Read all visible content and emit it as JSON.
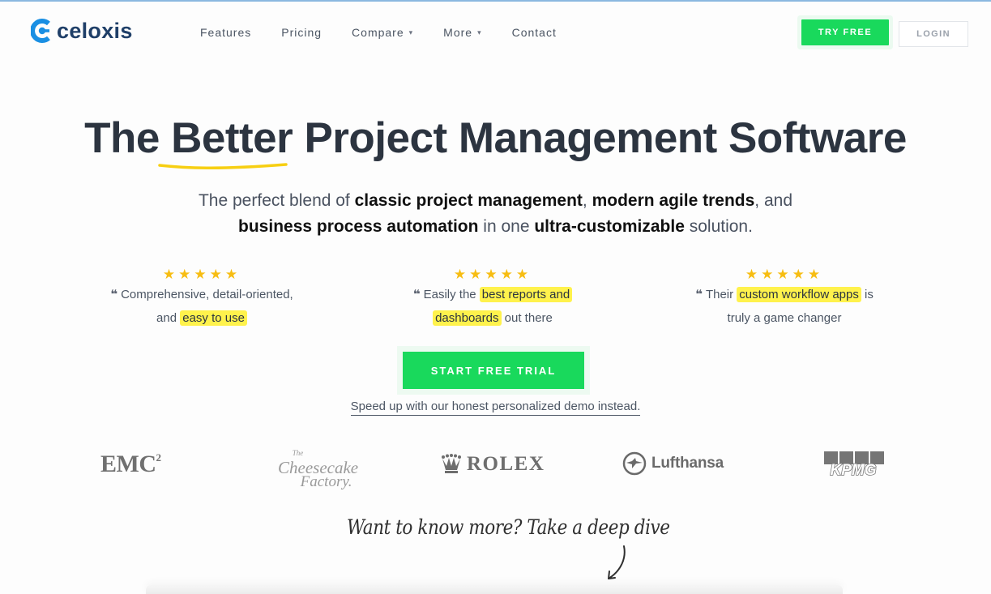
{
  "brand": {
    "name": "celoxis",
    "accent": "#19d95c",
    "logo_blue": "#1a8fe3"
  },
  "nav": {
    "items": [
      {
        "label": "Features",
        "has_dropdown": false
      },
      {
        "label": "Pricing",
        "has_dropdown": false
      },
      {
        "label": "Compare",
        "has_dropdown": true
      },
      {
        "label": "More",
        "has_dropdown": true
      },
      {
        "label": "Contact",
        "has_dropdown": false
      }
    ],
    "try_free": "TRY FREE",
    "login": "LOGIN"
  },
  "hero": {
    "headline_before": "The ",
    "headline_emphasis": "Better",
    "headline_after": " Project Management Software",
    "sub_line1": {
      "t1": "The perfect blend of ",
      "b1": "classic project management",
      "t2": ", ",
      "b2": "modern agile trends",
      "t3": ", and"
    },
    "sub_line2": {
      "b1": "business process automation",
      "t1": " in one ",
      "b2": "ultra-customizable",
      "t2": " solution."
    }
  },
  "testimonials": [
    {
      "stars": 5,
      "line1_text": "Comprehensive, detail-oriented,",
      "line2_pre": "and ",
      "line2_hl": "easy to use",
      "line2_post": ""
    },
    {
      "stars": 5,
      "line1_pre": "Easily the ",
      "line1_hl": "best reports and",
      "line2_hl": "dashboards",
      "line2_post": " out there"
    },
    {
      "stars": 5,
      "line1_pre": "Their ",
      "line1_hl": "custom workflow apps",
      "line1_post": " is",
      "line2_text": "truly a game changer"
    }
  ],
  "cta": {
    "start_trial": "START FREE TRIAL",
    "demo_link": "Speed up with our honest personalized demo instead."
  },
  "clients": {
    "emc": "EMC",
    "emc_sup": "2",
    "cheesecake_line1": "Cheesecake",
    "cheesecake_line2": "Factory.",
    "cheesecake_small": "The",
    "rolex": "ROLEX",
    "lufthansa": "Lufthansa",
    "kpmg": "KPMG"
  },
  "deep_dive": "Want to know more? Take a deep dive"
}
